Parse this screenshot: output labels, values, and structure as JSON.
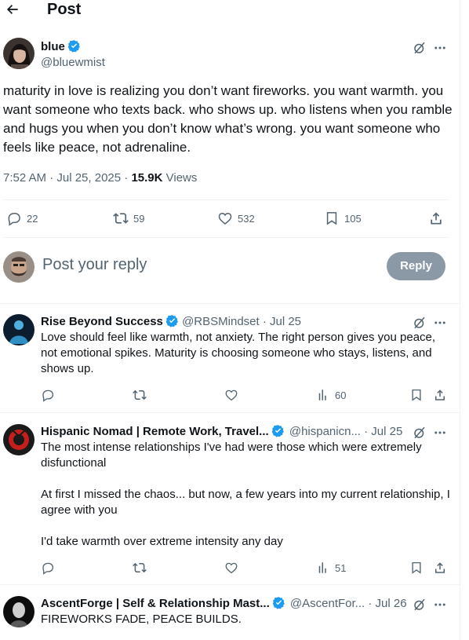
{
  "header": {
    "title": "Post"
  },
  "post": {
    "author_name": "blue",
    "author_handle": "@bluewmist",
    "text": "maturity in love is realizing you don’t want fireworks. you want warmth. you want someone who texts back. who shows up. who listens when you ramble and hugs you when you don’t know what’s wrong. you want someone who feels like peace, not adrenaline.",
    "timestamp": "7:52 AM · Jul 25, 2025 · ",
    "views_count": "15.9K",
    "views_label": " Views",
    "stats": {
      "replies": "22",
      "reposts": "59",
      "likes": "532",
      "bookmarks": "105"
    }
  },
  "reply_box": {
    "placeholder": "Post your reply",
    "button_label": "Reply"
  },
  "replies": [
    {
      "name": "Rise Beyond Success",
      "handle": "@RBSMindset",
      "date": " · Jul 25",
      "text": "Love should feel like warmth, not anxiety. The right person gives you peace, not emotional spikes. Maturity is choosing someone who stays, listens, and shows up.",
      "views": "60"
    },
    {
      "name": "Hispanic Nomad | Remote Work, Travel...",
      "handle": "@hispanicn...",
      "date": " · Jul 25",
      "text_lines": [
        "The most intense relationships I've had were those which were extremely disfunctional",
        "At first I missed the chaos... but now, a few years into my current relationship, I agree with you",
        "I'd take warmth over extreme intensity any day"
      ],
      "views": "51"
    },
    {
      "name": "AscentForge | Self & Relationship Mast...",
      "handle": "@AscentFor...",
      "date": " · Jul 26",
      "text": "FIREWORKS FADE, PEACE BUILDS."
    }
  ],
  "colors": {
    "text": "#0f1419",
    "muted": "#536471",
    "verified": "#1d9bf0",
    "reply_button": "#8b98a5",
    "border": "#eff3f4"
  }
}
